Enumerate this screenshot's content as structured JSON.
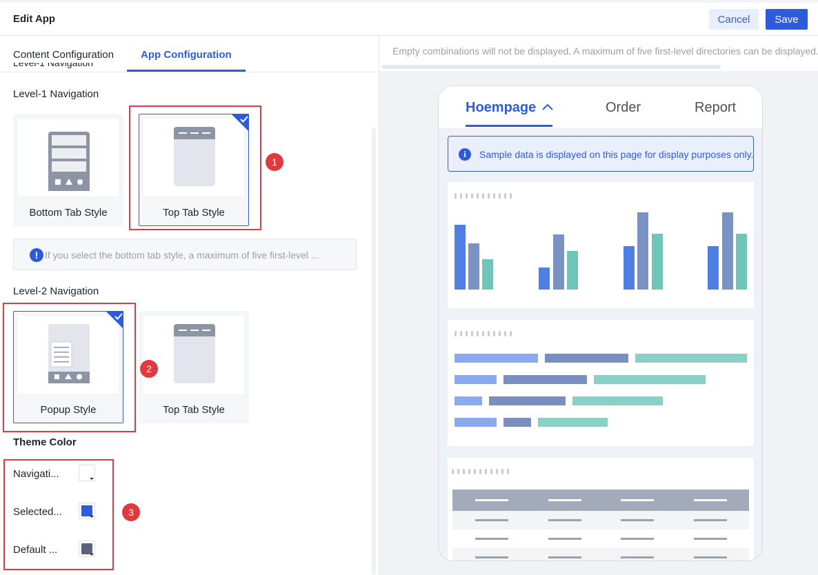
{
  "header": {
    "title": "Edit App",
    "cancel_label": "Cancel",
    "save_label": "Save"
  },
  "left_tabs": {
    "content": "Content Configuration",
    "app": "App Configuration",
    "active": "App Configuration"
  },
  "level1": {
    "title": "Level-1 Navigation",
    "options": [
      {
        "label": "Bottom Tab Style",
        "selected": false
      },
      {
        "label": "Top Tab Style",
        "selected": true
      }
    ],
    "info": "If you select the bottom tab style, a maximum of five first-level ..."
  },
  "level2": {
    "title": "Level-2 Navigation",
    "options": [
      {
        "label": "Popup Style",
        "selected": true
      },
      {
        "label": "Top Tab Style",
        "selected": false
      }
    ]
  },
  "theme": {
    "title": "Theme Color",
    "rows": [
      {
        "label": "Navigati...",
        "color": "#ffffff"
      },
      {
        "label": "Selected...",
        "color": "#2e5bd8"
      },
      {
        "label": "Default ...",
        "color": "#5a6378"
      }
    ]
  },
  "markers": [
    "1",
    "2",
    "3"
  ],
  "preview": {
    "notice": "Empty combinations will not be displayed. A maximum of five first-level directories can be displayed.",
    "tabs": [
      "Hoempage",
      "Order",
      "Report"
    ],
    "active_tab": "Hoempage",
    "sample_notice": "Sample data is displayed on this page for display purposes only."
  },
  "colors": {
    "accent": "#2e5bd8",
    "marker_red": "#e0393e",
    "chart_blue": "#4f7fe3",
    "chart_slate": "#7a93c3",
    "chart_teal": "#6fc6b8",
    "bar_light_blue": "#8aaaf0",
    "bar_slate": "#7a8fbf",
    "bar_teal": "#8ad0c6"
  }
}
